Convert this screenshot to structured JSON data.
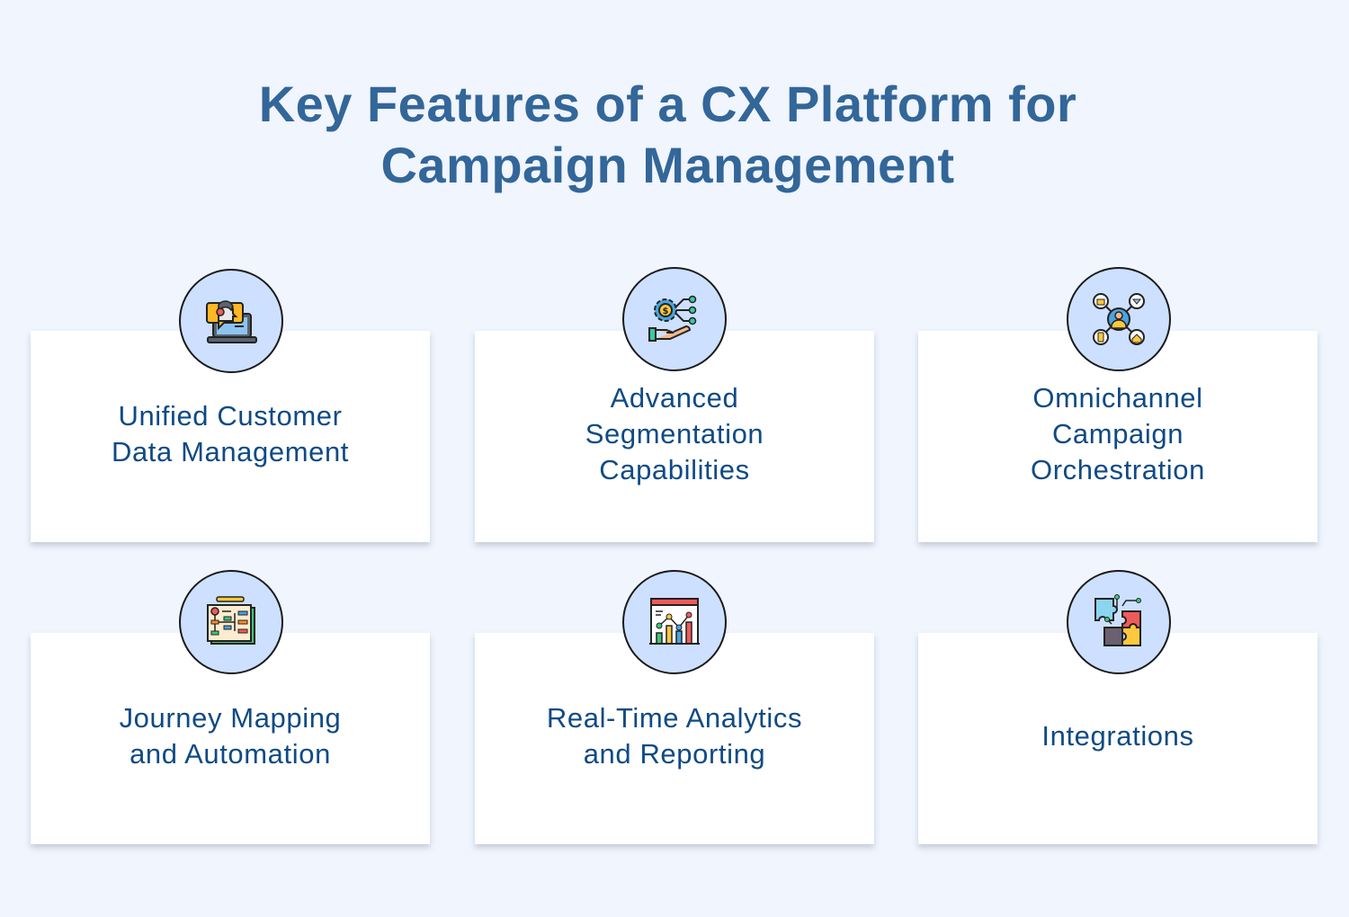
{
  "title": {
    "line1": "Key Features of a CX Platform for",
    "line2": "Campaign Management"
  },
  "features": [
    {
      "label": "Unified Customer\nData Management",
      "icon": "customer-support-laptop-icon"
    },
    {
      "label": "Advanced\nSegmentation\nCapabilities",
      "icon": "hand-gear-dollar-icon"
    },
    {
      "label": "Omnichannel\nCampaign\nOrchestration",
      "icon": "customer-network-icon"
    },
    {
      "label": "Journey Mapping\nand Automation",
      "icon": "flowchart-board-icon"
    },
    {
      "label": "Real-Time Analytics\nand Reporting",
      "icon": "analytics-dashboard-icon"
    },
    {
      "label": "Integrations",
      "icon": "puzzle-pieces-icon"
    }
  ],
  "colors": {
    "background": "#f0f5fe",
    "title": "#336699",
    "card_text": "#0f4a85",
    "icon_circle": "#cde0ff"
  }
}
